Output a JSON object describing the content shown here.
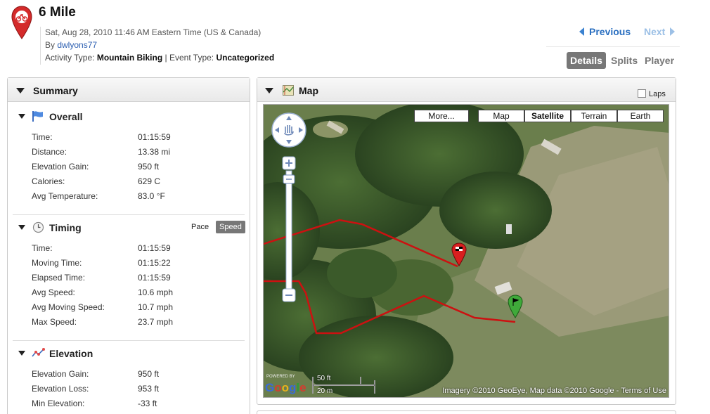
{
  "header": {
    "title": "6 Mile",
    "date": "Sat, Aug 28, 2010 11:46 AM Eastern Time (US & Canada)",
    "by_prefix": "By ",
    "by_user": "dwlyons77",
    "activity_type_label": "Activity Type:",
    "activity_type": "Mountain Biking",
    "event_sep": "|",
    "event_type_label": "Event Type:",
    "event_type": "Uncategorized",
    "prev_label": "Previous",
    "next_label": "Next",
    "view_tabs": [
      "Details",
      "Splits",
      "Player"
    ],
    "active_tab": "Details"
  },
  "summary": {
    "title": "Summary",
    "overall": {
      "title": "Overall",
      "rows": [
        {
          "label": "Time:",
          "value": "01:15:59"
        },
        {
          "label": "Distance:",
          "value": "13.38 mi"
        },
        {
          "label": "Elevation Gain:",
          "value": "950 ft"
        },
        {
          "label": "Calories:",
          "value": "629 C"
        },
        {
          "label": "Avg Temperature:",
          "value": "83.0 °F"
        }
      ]
    },
    "timing": {
      "title": "Timing",
      "pace_label": "Pace",
      "speed_label": "Speed",
      "rows": [
        {
          "label": "Time:",
          "value": "01:15:59"
        },
        {
          "label": "Moving Time:",
          "value": "01:15:22"
        },
        {
          "label": "Elapsed Time:",
          "value": "01:15:59"
        },
        {
          "label": "Avg Speed:",
          "value": "10.6 mph"
        },
        {
          "label": "Avg Moving Speed:",
          "value": "10.7 mph"
        },
        {
          "label": "Max Speed:",
          "value": "23.7 mph"
        }
      ]
    },
    "elevation": {
      "title": "Elevation",
      "rows": [
        {
          "label": "Elevation Gain:",
          "value": "950 ft"
        },
        {
          "label": "Elevation Loss:",
          "value": "953 ft"
        },
        {
          "label": "Min Elevation:",
          "value": "-33 ft"
        }
      ]
    }
  },
  "map": {
    "title": "Map",
    "laps_label": "Laps",
    "more_label": "More...",
    "types": [
      "Map",
      "Satellite",
      "Terrain",
      "Earth"
    ],
    "selected_type": "Satellite",
    "scale_ft": "50 ft",
    "scale_m": "20 m",
    "powered_by": "POWERED BY",
    "google": "Google",
    "copyright": "Imagery ©2010 GeoEye, Map data ©2010 Google - Terms of Use",
    "track_color": "#cc1111"
  },
  "icons": [
    "activity-pin-icon",
    "flag-icon",
    "clock-icon",
    "elevation-chart-icon",
    "map-icon",
    "pan-control-icon",
    "zoom-in-icon",
    "zoom-out-icon",
    "start-marker-icon",
    "finish-marker-icon"
  ]
}
